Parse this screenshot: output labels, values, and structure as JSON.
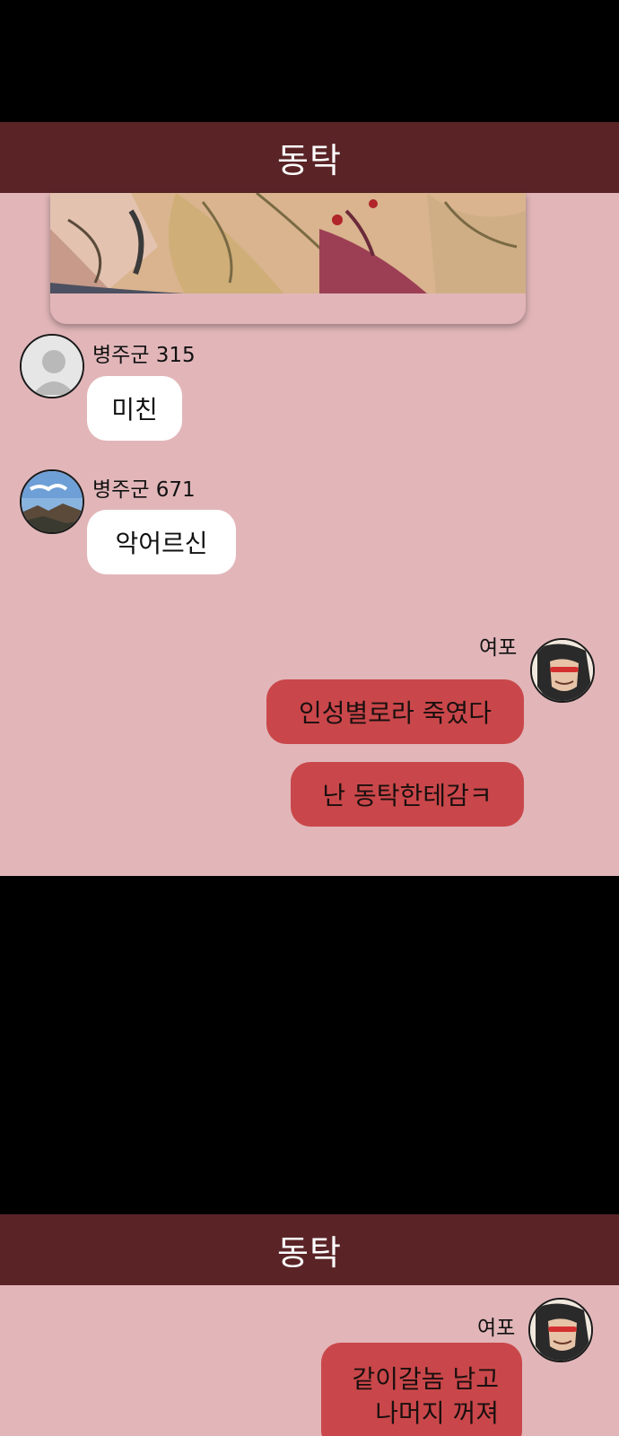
{
  "panel_top": {
    "header_title": "동탁",
    "messages": [
      {
        "sender": "병주군 315",
        "text": "미친",
        "avatar": "default-avatar-icon"
      },
      {
        "sender": "병주군 671",
        "text": "악어르신",
        "avatar": "landscape-photo-avatar"
      },
      {
        "sender": "여포",
        "text": "인성별로라 죽였다",
        "avatar": "character-portrait-avatar"
      },
      {
        "text": "난 동탁한테감ㅋ"
      }
    ]
  },
  "panel_bottom": {
    "header_title": "동탁",
    "messages": [
      {
        "sender": "여포",
        "avatar": "character-portrait-avatar",
        "lines": [
          "같이갈놈 남고",
          "나머지 꺼져"
        ]
      }
    ]
  },
  "colors": {
    "background": "#000000",
    "panel": "#e2b6b9",
    "header": "#5a2427",
    "incoming_bubble": "#ffffff",
    "outgoing_bubble": "#c9474a"
  }
}
